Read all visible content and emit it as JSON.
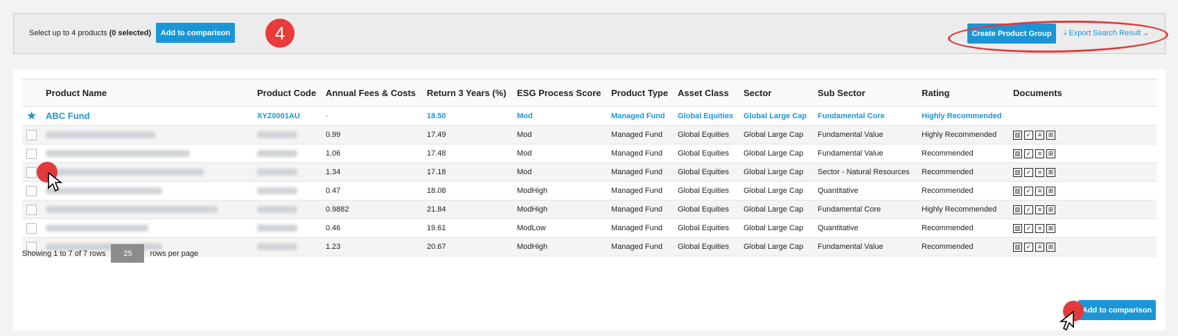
{
  "toolbar": {
    "select_prefix": "Select up to 4 products",
    "select_count": "(0 selected)",
    "add_label": "Add to comparison",
    "step": "4",
    "create_label": "Create Product Group",
    "export_label": "Export Search Result"
  },
  "table": {
    "headers": [
      "Product Name",
      "Product Code",
      "Annual Fees & Costs",
      "Return 3 Years (%)",
      "ESG Process Score",
      "Product Type",
      "Asset Class",
      "Sector",
      "Sub Sector",
      "Rating",
      "Documents"
    ],
    "favorite": {
      "name": "ABC Fund",
      "code": "XYZ0001AU",
      "fees": "-",
      "return": "18.50",
      "esg": "Mod",
      "type": "Managed Fund",
      "asset": "Global Equities",
      "sector": "Global Large Cap",
      "sub": "Fundamental Core",
      "rating": "Highly Recommended"
    },
    "rows": [
      {
        "fees": "0.99",
        "return": "17.49",
        "esg": "Mod",
        "type": "Managed Fund",
        "asset": "Global Equities",
        "sector": "Global Large Cap",
        "sub": "Fundamental Value",
        "rating": "Highly Recommended"
      },
      {
        "fees": "1.06",
        "return": "17.48",
        "esg": "Mod",
        "type": "Managed Fund",
        "asset": "Global Equities",
        "sector": "Global Large Cap",
        "sub": "Fundamental Value",
        "rating": "Recommended"
      },
      {
        "fees": "1.34",
        "return": "17.18",
        "esg": "Mod",
        "type": "Managed Fund",
        "asset": "Global Equities",
        "sector": "Global Large Cap",
        "sub": "Sector - Natural Resources",
        "rating": "Recommended"
      },
      {
        "fees": "0.47",
        "return": "18.08",
        "esg": "ModHigh",
        "type": "Managed Fund",
        "asset": "Global Equities",
        "sector": "Global Large Cap",
        "sub": "Quantitative",
        "rating": "Recommended"
      },
      {
        "fees": "0.9882",
        "return": "21.84",
        "esg": "ModHigh",
        "type": "Managed Fund",
        "asset": "Global Equities",
        "sector": "Global Large Cap",
        "sub": "Fundamental Core",
        "rating": "Highly Recommended"
      },
      {
        "fees": "0.46",
        "return": "19.61",
        "esg": "ModLow",
        "type": "Managed Fund",
        "asset": "Global Equities",
        "sector": "Global Large Cap",
        "sub": "Quantitative",
        "rating": "Recommended"
      },
      {
        "fees": "1.23",
        "return": "20.67",
        "esg": "ModHigh",
        "type": "Managed Fund",
        "asset": "Global Equities",
        "sector": "Global Large Cap",
        "sub": "Fundamental Value",
        "rating": "Recommended"
      }
    ]
  },
  "pager": {
    "showing": "Showing 1 to 7 of 7 rows",
    "page_size": "25",
    "suffix": "rows per page"
  },
  "bottom": {
    "add_label": "Add to comparison"
  },
  "colors": {
    "accent": "#1a96d6",
    "highlight": "#e23a3a"
  }
}
